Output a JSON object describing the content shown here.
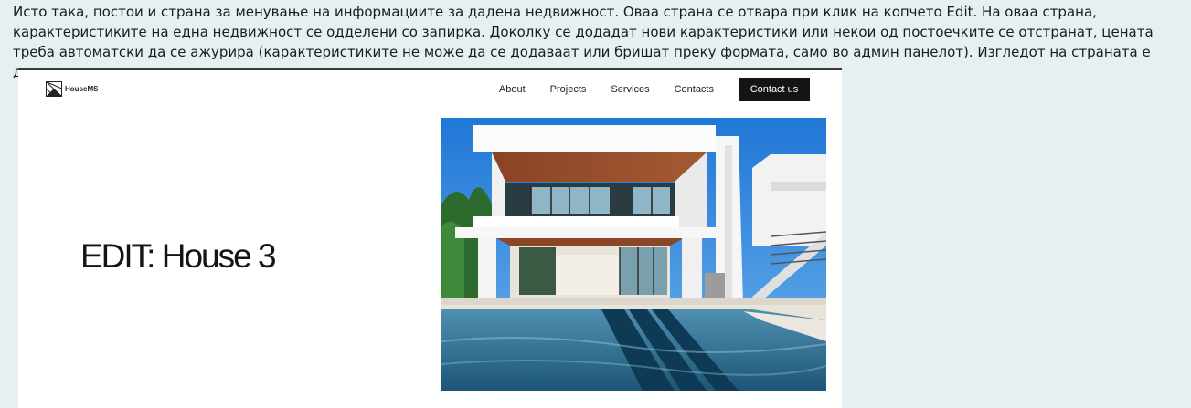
{
  "intro_text": "Исто така, постои и страна за менување на информациите за дадена недвижност. Оваа страна се отвара при клик на копчето Edit. На оваа страна, карактеристиките на една недвижност се одделени со запирка. Доколку се додадат нови карактеристики или некои од постоечките се отстранат, цената треба автоматски да се ажурира (карактеристиките не може да се додаваат или бришат преку формата, само во админ панелот). Изгледот на страната е даден во продолжение.",
  "site": {
    "logo_text": "HouseMS",
    "logo_icon": "house-logo-icon",
    "nav": {
      "about": "About",
      "projects": "Projects",
      "services": "Services",
      "contacts": "Contacts",
      "contact_button": "Contact us"
    },
    "page_title": "EDIT: House 3",
    "hero_image": "modern-house-with-pool"
  },
  "colors": {
    "page_background": "#e6f0f2",
    "button_background": "#141414",
    "frame_border": "#3a3a3a"
  }
}
